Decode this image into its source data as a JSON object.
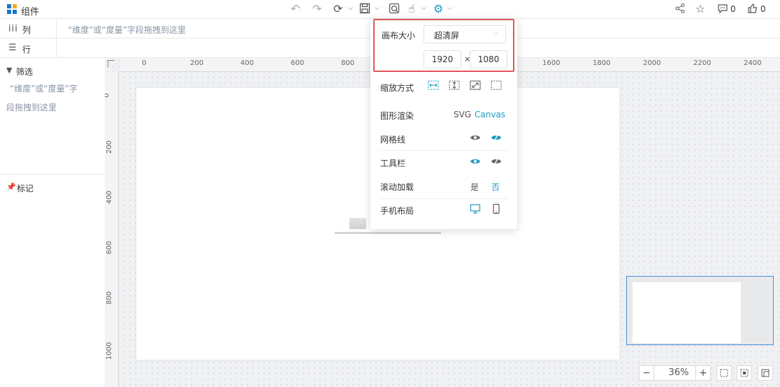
{
  "topbar": {
    "title": "组件",
    "share_count": "",
    "comment_count": "0",
    "like_count": "0"
  },
  "rows": {
    "columns_label": "列",
    "columns_hint": "“维度”或“度量”字段拖拽到这里",
    "rows_label": "行"
  },
  "left": {
    "filter_label": "筛选",
    "filter_hint_1": "“维度”或“度量”字",
    "filter_hint_2": "段拖拽到这里",
    "marks_label": "标记"
  },
  "ruler": {
    "h_ticks": [
      "0",
      "200",
      "400",
      "600",
      "800",
      "1600",
      "1800",
      "2000",
      "2200",
      "2400"
    ],
    "v_ticks": [
      "0",
      "200",
      "400",
      "600",
      "800",
      "1000"
    ]
  },
  "popup": {
    "canvas_size_label": "画布大小",
    "canvas_size_value": "超清屏",
    "width": "1920",
    "times": "×",
    "height": "1080",
    "scale_label": "缩放方式",
    "render_label": "图形渲染",
    "render_svg": "SVG",
    "render_canvas": "Canvas",
    "grid_label": "网格线",
    "toolbar_label": "工具栏",
    "scroll_label": "滚动加载",
    "scroll_yes": "是",
    "scroll_no": "否",
    "mobile_label": "手机布局"
  },
  "zoom": {
    "minus": "−",
    "value": "36%",
    "plus": "+"
  },
  "colors": {
    "accent": "#1a9bc4",
    "red_highlight": "#e0555a"
  }
}
